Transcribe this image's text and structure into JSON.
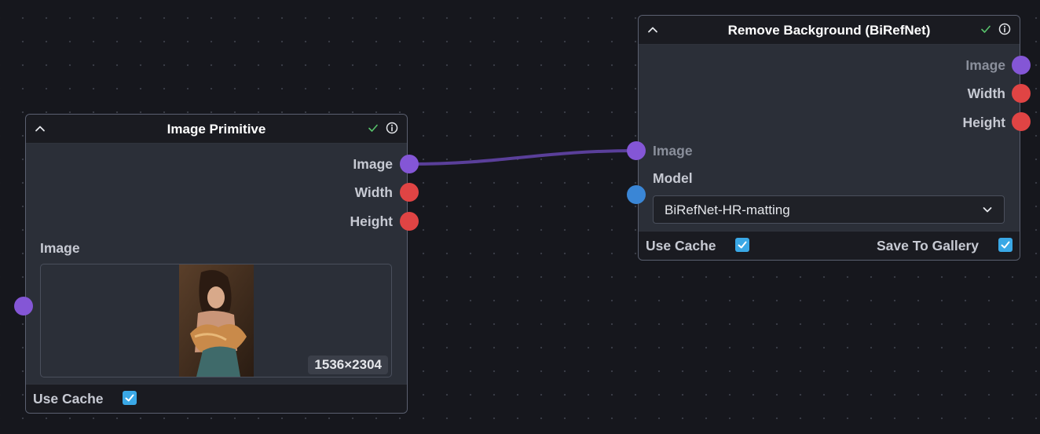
{
  "nodes": {
    "image_primitive": {
      "title": "Image Primitive",
      "outputs": [
        "Image",
        "Width",
        "Height"
      ],
      "field_label": "Image",
      "image_dims": "1536×2304",
      "use_cache_label": "Use Cache",
      "use_cache_checked": true
    },
    "remove_background": {
      "title": "Remove Background (BiRefNet)",
      "outputs": [
        "Image",
        "Width",
        "Height"
      ],
      "input_image_label": "Image",
      "model_label": "Model",
      "model_value": "BiRefNet-HR-matting",
      "use_cache_label": "Use Cache",
      "use_cache_checked": true,
      "save_to_gallery_label": "Save To Gallery",
      "save_to_gallery_checked": true
    }
  },
  "colors": {
    "canvas": "#16171d",
    "node_body": "#2b2f38",
    "node_header": "#1a1b21",
    "handle_image": "#8456d6",
    "handle_number": "#e04444",
    "handle_model": "#3a86d6",
    "checkbox": "#3aa8e6",
    "edge": "#5a3f9a"
  },
  "icons": {
    "collapse": "chevron-up-icon",
    "status": "check-icon",
    "info": "info-icon",
    "select": "chevron-down-icon"
  }
}
